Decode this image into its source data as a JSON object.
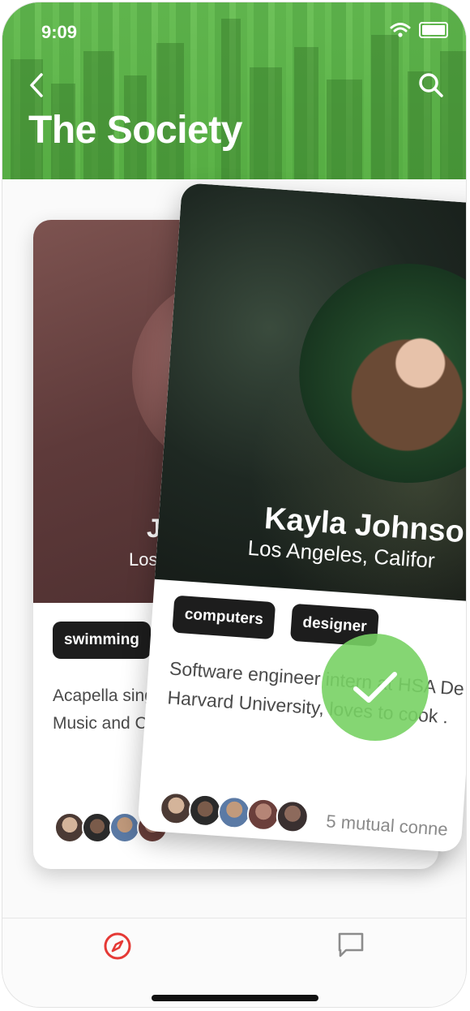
{
  "status_bar": {
    "time": "9:09"
  },
  "header": {
    "title": "The Society"
  },
  "icons": {
    "back": "chevron-left-icon",
    "search": "search-icon",
    "confirm": "check-icon",
    "explore": "compass-icon",
    "chat": "chat-bubble-icon"
  },
  "colors": {
    "header_green": "#5fae4c",
    "check_green": "#78d264",
    "explore_tab_active": "#e53935",
    "tag_bg": "#1d1d1d"
  },
  "cards": [
    {
      "name": "Jef",
      "location": "Los A",
      "tags": [
        "swimming",
        ""
      ],
      "description": "Acapella singe\nMusic and Co"
    },
    {
      "name": "Kayla Johnso",
      "location": "Los Angeles, Califor",
      "tags": [
        "computers",
        "designer"
      ],
      "description": "Software engineer intern at HSA De at Harvard University, loves to cook .",
      "mutual": "5 mutual conne"
    }
  ],
  "tabbar": {
    "active": "explore"
  }
}
